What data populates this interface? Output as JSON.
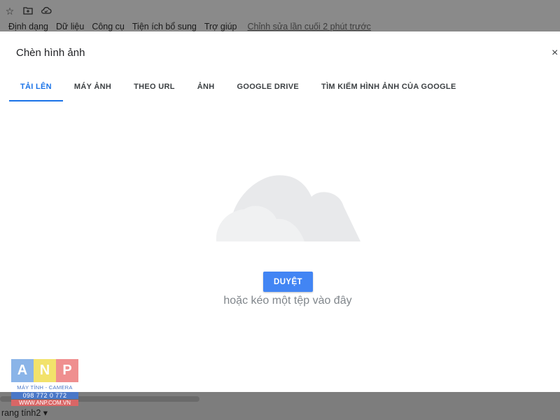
{
  "app": {
    "menu": [
      "Định dạng",
      "Dữ liệu",
      "Công cụ",
      "Tiện ích bổ sung",
      "Trợ giúp"
    ],
    "last_edit": "Chỉnh sửa lần cuối 2 phút trước",
    "sheet_tab": "rang tính2 ▾",
    "icons": [
      "star-icon",
      "move-to-folder-icon",
      "cloud-status-icon"
    ]
  },
  "dialog": {
    "title": "Chèn hình ảnh",
    "close_label": "×",
    "tabs": [
      {
        "label": "TẢI LÊN",
        "active": true
      },
      {
        "label": "MÁY ẢNH",
        "active": false
      },
      {
        "label": "THEO URL",
        "active": false
      },
      {
        "label": "ẢNH",
        "active": false
      },
      {
        "label": "GOOGLE DRIVE",
        "active": false
      },
      {
        "label": "TÌM KIẾM HÌNH ẢNH CỦA GOOGLE",
        "active": false
      }
    ],
    "browse_label": "DUYỆT",
    "drop_hint": "hoặc kéo một tệp vào đây"
  },
  "watermark": {
    "letters": [
      "A",
      "N",
      "P"
    ],
    "subtitle": "MÁY TÍNH - CAMERA",
    "phone": "098 772 0 772",
    "url": "WWW.ANP.COM.VN"
  },
  "colors": {
    "accent": "#1a73e8",
    "button": "#4285f4",
    "cloud": "#e8e9eb"
  }
}
